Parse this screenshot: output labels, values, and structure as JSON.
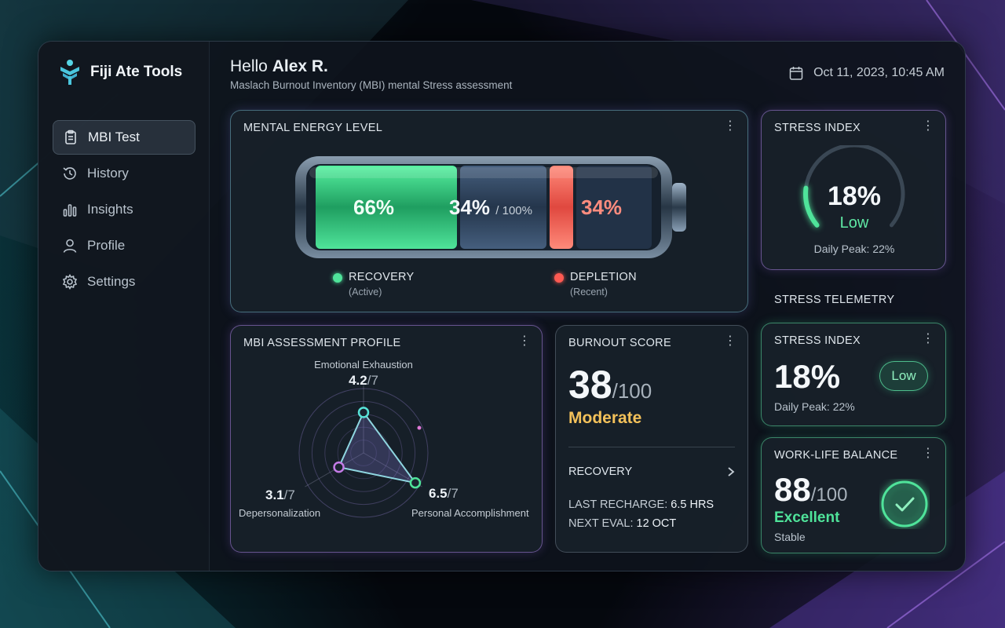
{
  "brand": {
    "name": "Fiji Ate Tools"
  },
  "header": {
    "greeting_prefix": "Hello",
    "user_name": "Alex R.",
    "subtitle": "Maslach Burnout Inventory (MBI) mental Stress assessment",
    "datetime": "Oct 11, 2023, 10:45 AM"
  },
  "nav": {
    "items": [
      {
        "label": "MBI Test",
        "icon": "clipboard-icon",
        "active": true
      },
      {
        "label": "History",
        "icon": "history-icon"
      },
      {
        "label": "Insights",
        "icon": "bar-chart-icon"
      },
      {
        "label": "Profile",
        "icon": "user-icon"
      },
      {
        "label": "Settings",
        "icon": "gear-icon"
      }
    ]
  },
  "energy": {
    "title": "MENTAL ENERGY LEVEL",
    "recovery_pct": 66,
    "recovery_label": "66%",
    "middle_label": "34%",
    "middle_suffix": "/ 100%",
    "depletion_label": "34%",
    "legend_recovery": "RECOVERY",
    "legend_recovery_sub": "(Active)",
    "legend_depletion": "DEPLETION",
    "legend_depletion_sub": "(Recent)"
  },
  "stress_index_top": {
    "title": "STRESS INDEX",
    "value": "18%",
    "level_fraction": 0.18,
    "status": "Low",
    "peak": "Daily Peak: 22%"
  },
  "telemetry": {
    "label": "STRESS TELEMETRY"
  },
  "stress_index_small": {
    "title": "STRESS INDEX",
    "value": "18%",
    "badge": "Low",
    "peak": "Daily Peak: 22%"
  },
  "mbi_profile": {
    "title": "MBI ASSESSMENT PROFILE",
    "axes": [
      {
        "name": "Emotional Exhaustion",
        "score": "4.2",
        "max": "/7",
        "value": 4.2
      },
      {
        "name": "Personal Accomplishment",
        "score": "6.5",
        "max": "/7",
        "value": 6.5
      },
      {
        "name": "Depersonalization",
        "score": "3.1",
        "max": "/7",
        "value": 3.1
      }
    ]
  },
  "burnout": {
    "title": "BURNOUT SCORE",
    "score": "38",
    "max": "/100",
    "status": "Moderate",
    "recovery_label": "RECOVERY",
    "recharge_label": "LAST RECHARGE:",
    "recharge_value": "6.5 HRS",
    "eval_label": "NEXT EVAL:",
    "eval_value": "12 OCT"
  },
  "work_life": {
    "title": "WORK-LIFE BALANCE",
    "score": "88",
    "max": "/100",
    "status": "Excellent",
    "trend": "Stable"
  },
  "colors": {
    "green": "#4fe39a",
    "red": "#ff5a52",
    "amber": "#f3c15a",
    "cyan": "#57e3d8",
    "purple": "#b37ce8"
  }
}
